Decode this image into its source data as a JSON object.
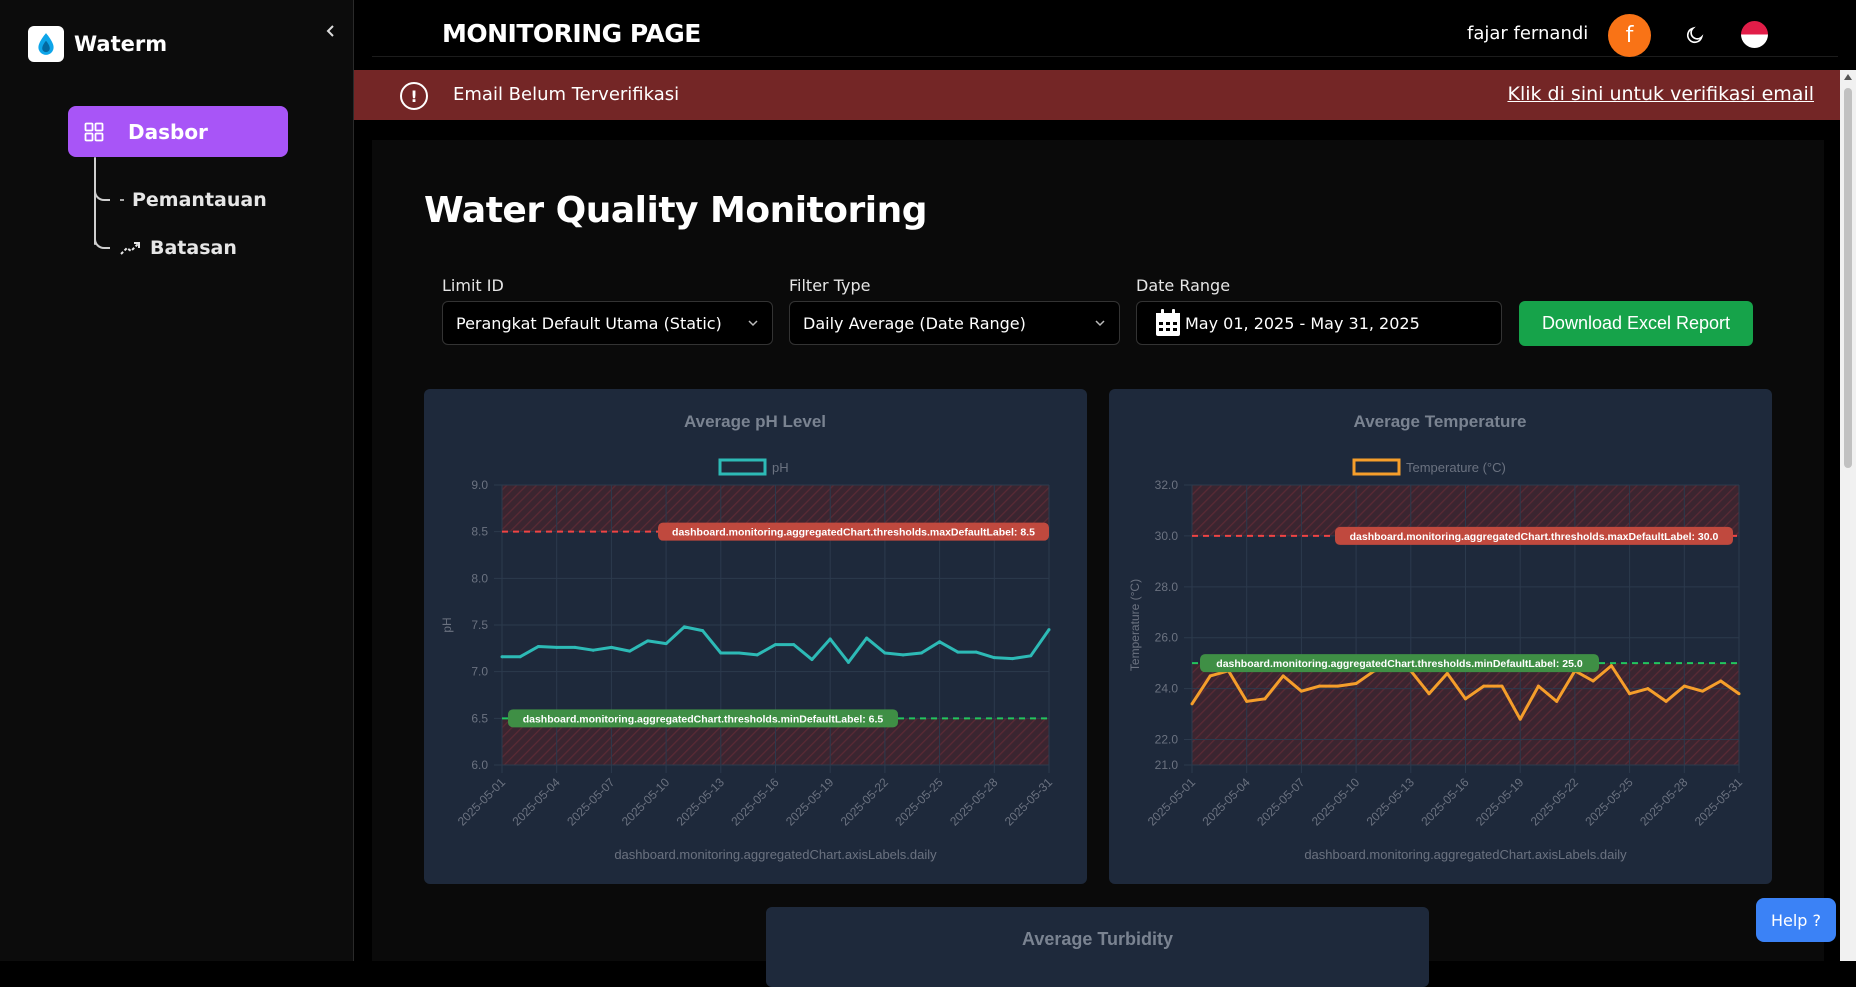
{
  "sidebar": {
    "brand": "Waterm",
    "items": [
      {
        "label": "Dasbor"
      },
      {
        "label": "Pemantauan"
      },
      {
        "label": "Batasan"
      }
    ]
  },
  "header": {
    "title": "MONITORING PAGE",
    "user_name": "fajar fernandi",
    "avatar_letter": "f"
  },
  "alert": {
    "text": "Email Belum Terverifikasi",
    "link": "Klik di sini untuk verifikasi email"
  },
  "main": {
    "title": "Water Quality Monitoring",
    "filters": {
      "limit_label": "Limit ID",
      "limit_value": "Perangkat Default Utama (Static)",
      "filter_label": "Filter Type",
      "filter_value": "Daily Average (Date Range)",
      "date_label": "Date Range",
      "date_value": "May 01, 2025 - May 31, 2025"
    },
    "download_label": "Download Excel Report"
  },
  "help_label": "Help ?",
  "colors": {
    "accent": "#a855f7",
    "alert_bg": "#742626",
    "download": "#16a34a",
    "ph_line": "#2dbab6",
    "temp_line": "#f59e2b",
    "max_threshold": "#ef4444",
    "min_threshold": "#22c55e"
  },
  "chart_data": [
    {
      "type": "line",
      "title": "Average pH Level",
      "ylabel": "pH",
      "xlabel": "dashboard.monitoring.aggregatedChart.axisLabels.daily",
      "ylim": [
        6.0,
        9.0
      ],
      "yticks": [
        "9.0",
        "8.5",
        "8.0",
        "7.5",
        "7.0",
        "6.5",
        "6.0"
      ],
      "ytick_values": [
        9.0,
        8.5,
        8.0,
        7.5,
        7.0,
        6.5,
        6.0
      ],
      "xtick_labels": [
        "2025-05-01",
        "2025-05-04",
        "2025-05-07",
        "2025-05-10",
        "2025-05-13",
        "2025-05-16",
        "2025-05-19",
        "2025-05-22",
        "2025-05-25",
        "2025-05-28",
        "2025-05-31"
      ],
      "xtick_indices": [
        0,
        3,
        6,
        9,
        12,
        15,
        18,
        21,
        24,
        27,
        30
      ],
      "series": [
        {
          "name": "pH",
          "values": [
            7.16,
            7.16,
            7.27,
            7.26,
            7.26,
            7.23,
            7.26,
            7.22,
            7.33,
            7.3,
            7.48,
            7.44,
            7.2,
            7.2,
            7.18,
            7.29,
            7.29,
            7.13,
            7.35,
            7.1,
            7.36,
            7.2,
            7.18,
            7.2,
            7.32,
            7.21,
            7.21,
            7.15,
            7.14,
            7.17,
            7.45
          ]
        }
      ],
      "max_threshold": 8.5,
      "min_threshold": 6.5,
      "max_label": "dashboard.monitoring.aggregatedChart.thresholds.maxDefaultLabel: 8.5",
      "min_label": "dashboard.monitoring.aggregatedChart.thresholds.minDefaultLabel: 6.5",
      "grid": true,
      "legend": "top"
    },
    {
      "type": "line",
      "title": "Average Temperature",
      "ylabel": "Temperature (°C)",
      "xlabel": "dashboard.monitoring.aggregatedChart.axisLabels.daily",
      "ylim": [
        21.0,
        32.0
      ],
      "yticks": [
        "32.0",
        "30.0",
        "28.0",
        "26.0",
        "24.0",
        "22.0",
        "21.0"
      ],
      "ytick_values": [
        32.0,
        30.0,
        28.0,
        26.0,
        24.0,
        22.0,
        21.0
      ],
      "xtick_labels": [
        "2025-05-01",
        "2025-05-04",
        "2025-05-07",
        "2025-05-10",
        "2025-05-13",
        "2025-05-16",
        "2025-05-19",
        "2025-05-22",
        "2025-05-25",
        "2025-05-28",
        "2025-05-31"
      ],
      "xtick_indices": [
        0,
        3,
        6,
        9,
        12,
        15,
        18,
        21,
        24,
        27,
        30
      ],
      "series": [
        {
          "name": "Temperature (°C)",
          "values": [
            23.4,
            24.5,
            24.7,
            23.5,
            23.6,
            24.5,
            23.9,
            24.1,
            24.1,
            24.2,
            24.7,
            24.8,
            24.7,
            23.8,
            24.6,
            23.6,
            24.1,
            24.1,
            22.8,
            24.1,
            23.5,
            24.7,
            24.3,
            24.9,
            23.8,
            24.0,
            23.5,
            24.1,
            23.9,
            24.3,
            23.8
          ]
        }
      ],
      "max_threshold": 30.0,
      "min_threshold": 25.0,
      "max_label": "dashboard.monitoring.aggregatedChart.thresholds.maxDefaultLabel: 30.0",
      "min_label": "dashboard.monitoring.aggregatedChart.thresholds.minDefaultLabel: 25.0",
      "grid": true,
      "legend": "top"
    },
    {
      "type": "line",
      "title": "Average Turbidity"
    }
  ]
}
